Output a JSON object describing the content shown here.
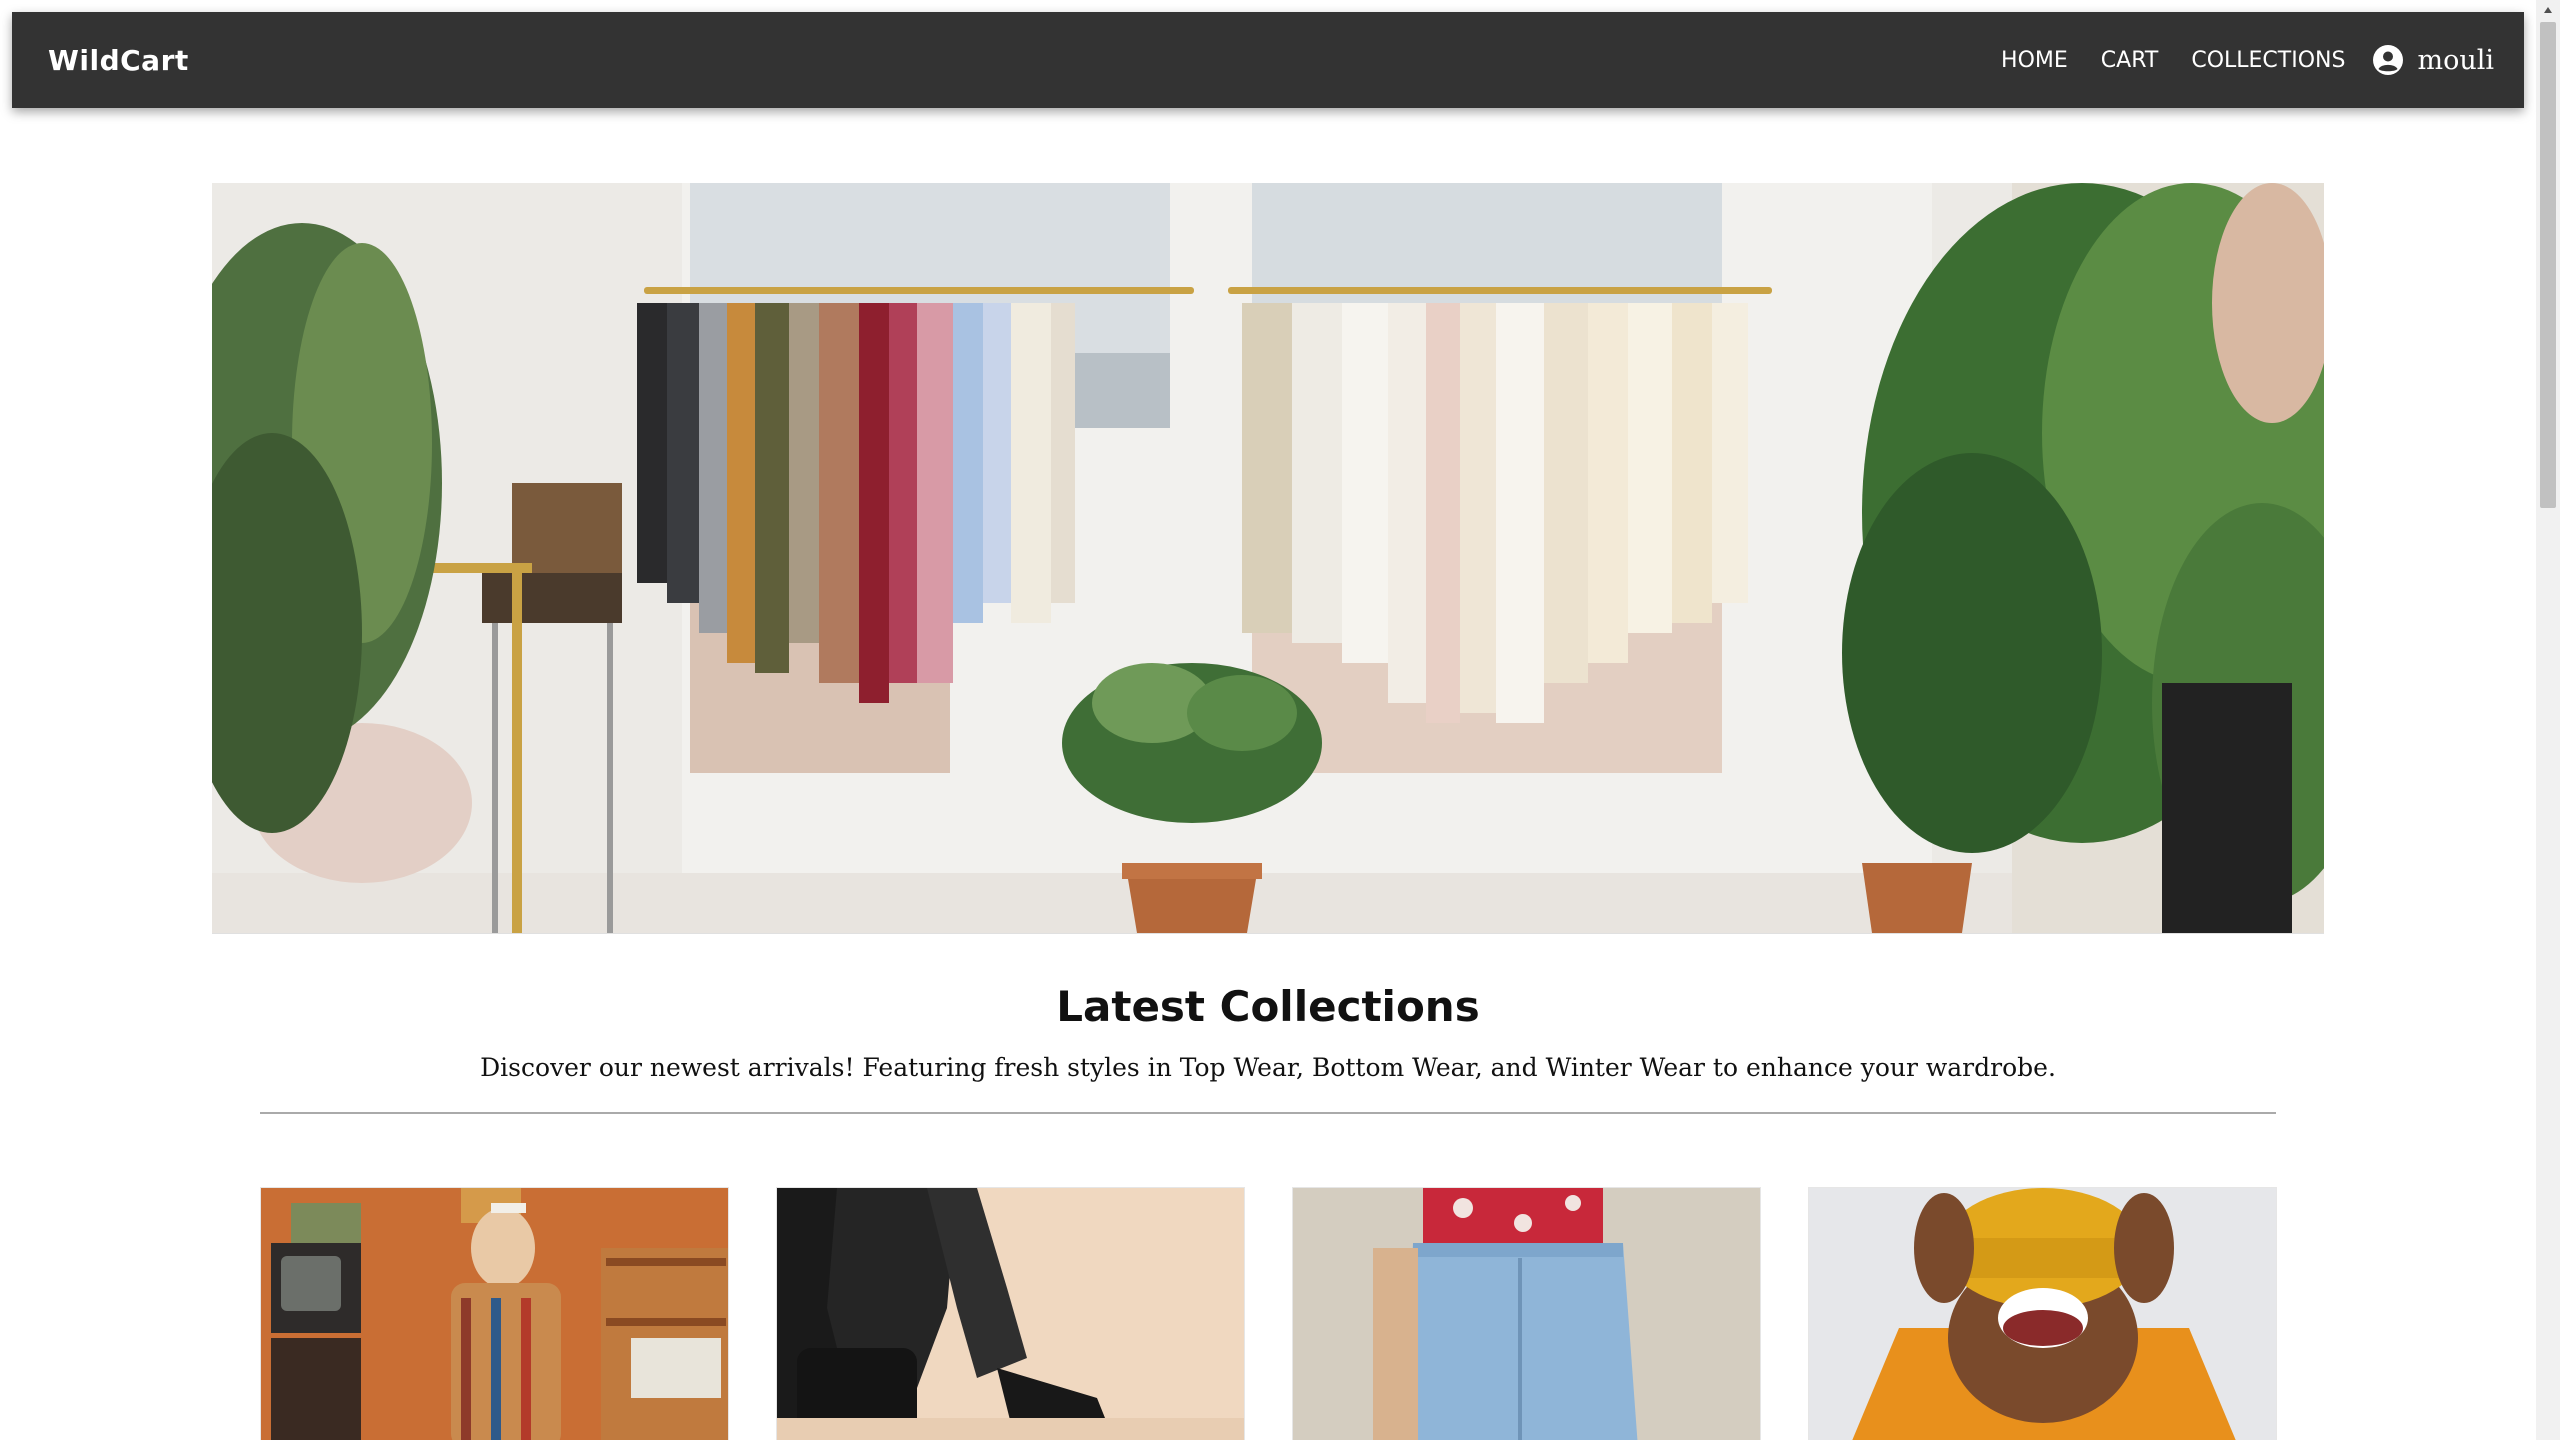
{
  "navbar": {
    "brand": "WildCart",
    "links": [
      "HOME",
      "CART",
      "COLLECTIONS"
    ],
    "user": "mouli"
  },
  "hero": {
    "image": "clothing-rack-with-plants"
  },
  "section": {
    "title": "Latest Collections",
    "subtitle": "Discover our newest arrivals! Featuring fresh styles in Top Wear, Bottom Wear, and Winter Wear to enhance your wardrobe."
  },
  "cards": [
    {
      "image": "child-in-plaid-shirt-photo"
    },
    {
      "image": "leather-boots-photo"
    },
    {
      "image": "denim-jeans-photo"
    },
    {
      "image": "yellow-beanie-photo"
    }
  ],
  "colors": {
    "navbar_bg": "#333333",
    "text": "#111111",
    "divider": "#aaaaaa"
  }
}
